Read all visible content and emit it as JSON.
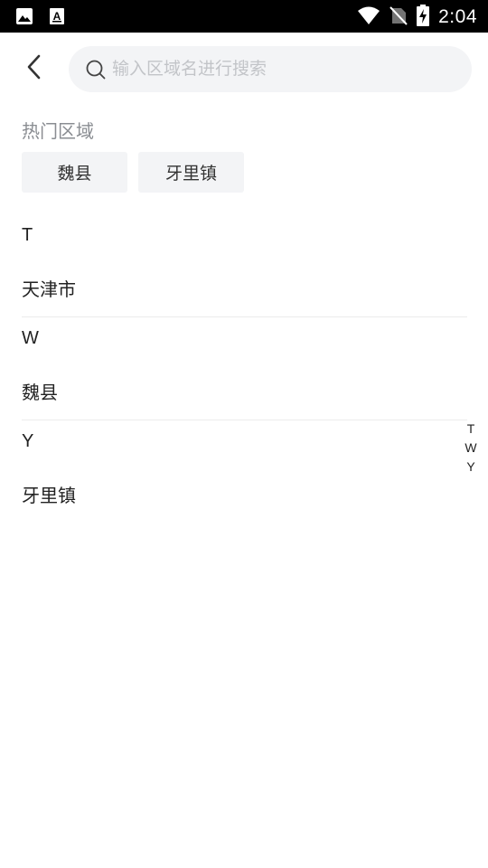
{
  "status_bar": {
    "time": "2:04",
    "icons": [
      "image-icon",
      "font-icon",
      "wifi-icon",
      "no-sim-icon",
      "battery-charging-icon"
    ]
  },
  "header": {
    "back_icon": "chevron-left-icon",
    "search_placeholder": "输入区域名进行搜索",
    "search_value": ""
  },
  "hot_areas": {
    "title": "热门区域",
    "items": [
      "魏县",
      "牙里镇"
    ]
  },
  "sections": [
    {
      "letter": "T",
      "cities": [
        "天津市"
      ]
    },
    {
      "letter": "W",
      "cities": [
        "魏县"
      ]
    },
    {
      "letter": "Y",
      "cities": [
        "牙里镇"
      ]
    }
  ],
  "index_bar": [
    "T",
    "W",
    "Y"
  ],
  "colors": {
    "status_bar_bg": "#000000",
    "search_bg": "#f3f4f6",
    "chip_bg": "#f3f4f6",
    "muted_text": "#8a8d92",
    "divider": "#ececec"
  }
}
